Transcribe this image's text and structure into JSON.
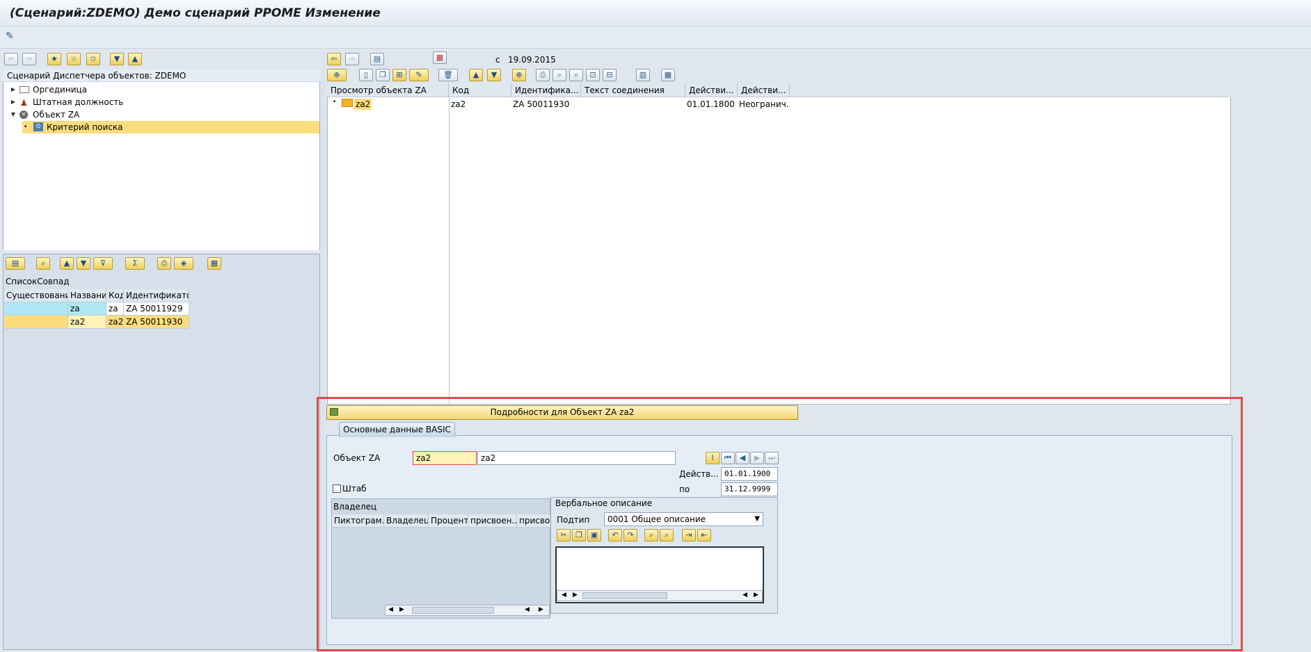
{
  "window": {
    "title": "(Сценарий:ZDEMO) Демо сценарий PPOME Изменение"
  },
  "left_panel": {
    "title": "Сценарий Диспетчера объектов: ZDEMO",
    "tree": [
      {
        "label": "Оргединица",
        "icon": "org-unit-icon"
      },
      {
        "label": "Штатная должность",
        "icon": "position-icon"
      },
      {
        "label": "Объект ZA",
        "icon": "object-icon"
      },
      {
        "label": "Критерий поиска",
        "icon": "binoculars-icon"
      }
    ],
    "hitlist": {
      "label": "СписокСовпад",
      "columns": [
        "Существование",
        "Название",
        "Код",
        "Идентификатор"
      ],
      "rows": [
        {
          "exist": "",
          "name": "za",
          "code": "za",
          "id": "ZA 50011929"
        },
        {
          "exist": "",
          "name": "za2",
          "code": "za2",
          "id": "ZA 50011930"
        }
      ]
    }
  },
  "right_panel": {
    "date_prefix": "с",
    "date": "19.09.2015",
    "columns": [
      "Просмотр объекта ZA",
      "Код",
      "Идентифика...",
      "Текст соединения",
      "Действи...",
      "Действи..."
    ],
    "row": {
      "name": "za2",
      "code": "za2",
      "id": "ZA 50011930",
      "text": "",
      "from": "01.01.1800",
      "to": "Неогранич."
    }
  },
  "detail": {
    "header": "Подробности для Объект ZA za2",
    "tab": "Основные данные BASIC",
    "object_label": "Объект ZA",
    "object_code": "za2",
    "object_name": "za2",
    "valid_label": "Действ...",
    "valid_from": "01.01.1900",
    "to_label": "по",
    "valid_to": "31.12.9999",
    "staff_label": "Штаб",
    "owner": {
      "title": "Владелец",
      "columns": [
        "Пиктограм...",
        "Владелец",
        "Процент",
        "присвоен...",
        "присвое"
      ]
    },
    "verbal": {
      "title": "Вербальное описание",
      "subtype_label": "Подтип",
      "subtype_value": "0001 Общее описание",
      "text": ""
    }
  }
}
